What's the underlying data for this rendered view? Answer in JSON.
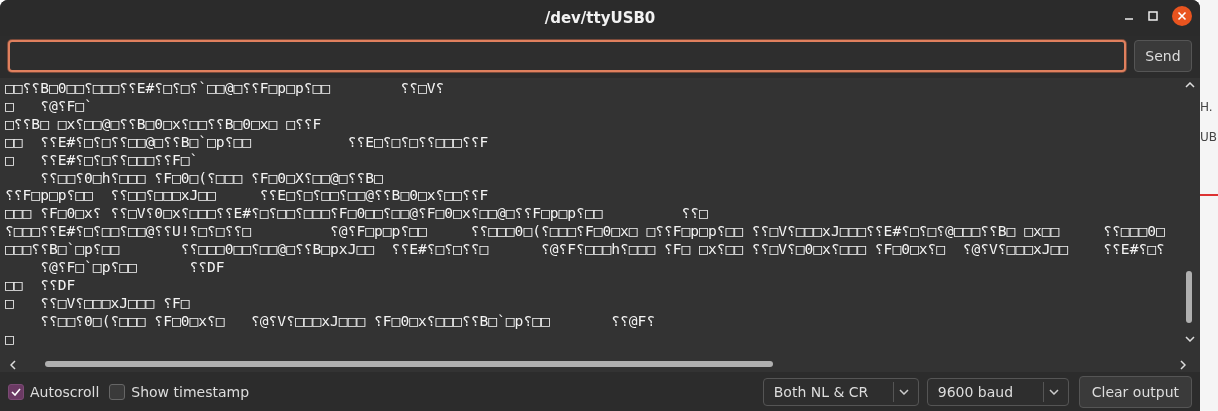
{
  "window": {
    "title": "/dev/ttyUSB0"
  },
  "send_button": "Send",
  "output_lines": [
    "□□⸮⸮B□0□□⸮□□□⸮⸮E#⸮□⸮□⸮`□□@□⸮⸮F□p□p⸮□□        ⸮⸮□V⸮",
    "□   ⸮@⸮F□`",
    "□⸮⸮B□ □x⸮□□@□⸮⸮B□0□x⸮□□⸮⸮B□0□x□ □⸮⸮F",
    "□□  ⸮⸮E#⸮□⸮□⸮⸮□□@□⸮⸮B□`□p⸮□□           ⸮⸮E□⸮□⸮□⸮⸮□□□⸮⸮F",
    "□   ⸮⸮E#⸮□⸮□⸮⸮□□□⸮⸮F□`",
    "    ⸮⸮□□⸮0□h⸮□□□ ⸮F□0□(⸮□□□ ⸮F□0□X⸮□□@□⸮⸮B□",
    "⸮⸮F□p□p⸮□□  ⸮⸮□□⸮□□□xJ□□     ⸮⸮E□⸮□⸮□□⸮□□@⸮⸮B□0□x⸮□□⸮⸮F",
    "□□□ ⸮F□0□x⸮ ⸮⸮□V⸮0□x⸮□□□⸮⸮E#⸮□⸮□□⸮□□□⸮F□0□□⸮□□@⸮F□0□x⸮□□@□⸮⸮F□p□p⸮□□         ⸮⸮□",
    "⸮□□□⸮⸮E#⸮□⸮□□⸮□□@⸮⸮U!⸮□⸮□⸮⸮□         ⸮@⸮F□p□p⸮□□     ⸮⸮□□□0□(⸮□□□⸮F□0□x□ □⸮⸮F□p□p⸮□□ ⸮⸮□V⸮□□□xJ□□□⸮⸮E#⸮□⸮□⸮@□□□⸮⸮B□ □x□□     ⸮⸮□□□0□",
    "□□□⸮⸮B□`□p⸮□□       ⸮⸮□□□0□□⸮□□@□⸮⸮B□pxJ□□  ⸮⸮E#⸮□⸮□⸮⸮□      ⸮@⸮F⸮□□□h⸮□□□ ⸮F□ □x⸮□□ ⸮⸮□V⸮□0□x⸮□□□ ⸮F□0□x⸮□  ⸮@⸮V⸮□□□xJ□□    ⸮⸮E#⸮□⸮",
    "    ⸮@⸮F□`□p⸮□□      ⸮⸮DF",
    "□□  ⸮⸮DF",
    "□   ⸮⸮□V⸮□□□xJ□□□ ⸮F□",
    "    ⸮⸮□□⸮0□(⸮□□□ ⸮F□0□x⸮□   ⸮@⸮V⸮□□□xJ□□□ ⸮F□0□x⸮□□□⸮⸮B□`□p⸮□□       ⸮⸮@F⸮",
    "□"
  ],
  "autoscroll": {
    "label": "Autoscroll",
    "checked": true
  },
  "show_timestamp": {
    "label": "Show timestamp",
    "checked": false
  },
  "line_ending": "Both NL & CR",
  "baud_rate": "9600 baud",
  "clear_button": "Clear output",
  "background_window": {
    "texts": [
      "H.",
      "UB"
    ]
  }
}
